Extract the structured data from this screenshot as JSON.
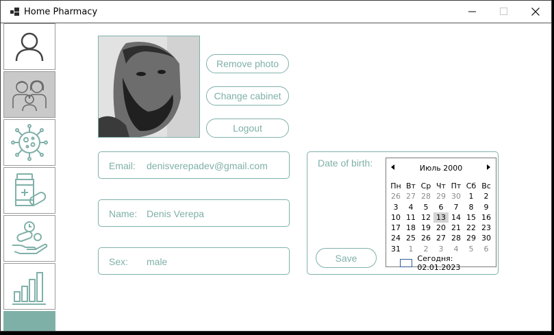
{
  "window": {
    "title": "Home Pharmacy",
    "controls": {
      "minimize": "minimize",
      "maximize": "maximize",
      "close": "close"
    }
  },
  "sidebar": {
    "items": [
      {
        "name": "profile",
        "icon": "user-icon",
        "active": false
      },
      {
        "name": "family",
        "icon": "family-icon",
        "active": true
      },
      {
        "name": "virus",
        "icon": "virus-icon",
        "active": false
      },
      {
        "name": "medicines",
        "icon": "pills-icon",
        "active": false
      },
      {
        "name": "schedule",
        "icon": "hand-pill-clock-icon",
        "active": false
      },
      {
        "name": "statistics",
        "icon": "bar-chart-icon",
        "active": false
      }
    ],
    "footer_color": "#7fb0a8"
  },
  "profile": {
    "buttons": {
      "remove_photo": "Remove photo",
      "change_cabinet": "Change cabinet",
      "logout": "Logout"
    },
    "email": {
      "label": "Email:",
      "value": "denisverepadev@gmail.com"
    },
    "name": {
      "label": "Name:",
      "value": "Denis Verepa"
    },
    "sex": {
      "label": "Sex:",
      "value": "male"
    },
    "dob_label": "Date of birth:",
    "save_label": "Save"
  },
  "calendar": {
    "title": "Июль 2000",
    "weekdays": [
      "Пн",
      "Вт",
      "Ср",
      "Чт",
      "Пт",
      "Сб",
      "Вс"
    ],
    "weeks": [
      [
        "26",
        "27",
        "28",
        "29",
        "30",
        "1",
        "2"
      ],
      [
        "3",
        "4",
        "5",
        "6",
        "7",
        "8",
        "9"
      ],
      [
        "10",
        "11",
        "12",
        "13",
        "14",
        "15",
        "16"
      ],
      [
        "17",
        "18",
        "19",
        "20",
        "21",
        "22",
        "23"
      ],
      [
        "24",
        "25",
        "26",
        "27",
        "28",
        "29",
        "30"
      ],
      [
        "31",
        "1",
        "2",
        "3",
        "4",
        "5",
        "6"
      ]
    ],
    "selected": "13",
    "today_label": "Сегодня: 02.01.2023"
  },
  "colors": {
    "accent": "#7fb0a8",
    "selected_nav": "#c9c9c9"
  }
}
